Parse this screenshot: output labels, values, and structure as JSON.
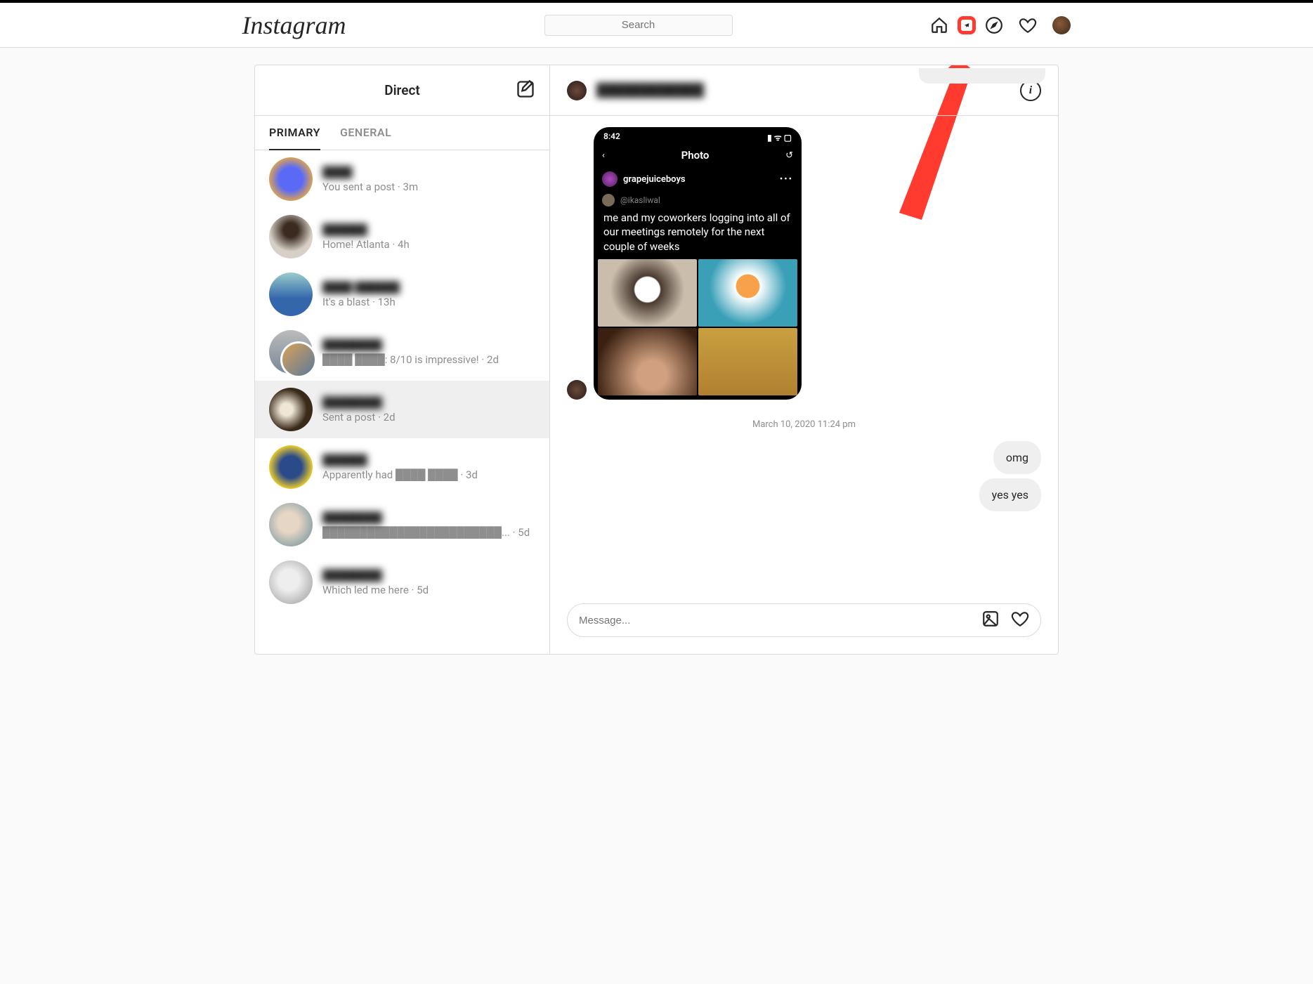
{
  "brand": "Instagram",
  "search": {
    "placeholder": "Search"
  },
  "sidebar": {
    "title": "Direct",
    "tabs": {
      "primary": "PRIMARY",
      "general": "GENERAL"
    },
    "threads": [
      {
        "name": "████",
        "preview": "You sent a post · 3m"
      },
      {
        "name": "██████",
        "preview": "Home! Atlanta · 4h"
      },
      {
        "name": "████ ██████",
        "preview": "It's a blast · 13h"
      },
      {
        "name": "████████",
        "preview": "████ ████: 8/10 is impressive! · 2d"
      },
      {
        "name": "████████",
        "preview": "Sent a post · 2d",
        "selected": true
      },
      {
        "name": "██████",
        "preview": "Apparently had ████ ████ · 3d"
      },
      {
        "name": "████████",
        "preview": "████████████████████████... · 5d"
      },
      {
        "name": "████████",
        "preview": "Which led me here · 5d"
      }
    ]
  },
  "chat": {
    "header_name": "████████████",
    "info_glyph": "i",
    "shared_post": {
      "status_time": "8:42",
      "nav_title": "Photo",
      "account": "grapejuiceboys",
      "quoted": "@ikasliwal",
      "text": "me and my coworkers logging into all of our meetings remotely for the next couple of weeks"
    },
    "timestamp": "March 10, 2020 11:24 pm",
    "bubbles": [
      "omg",
      "yes yes"
    ],
    "input_placeholder": "Message..."
  }
}
